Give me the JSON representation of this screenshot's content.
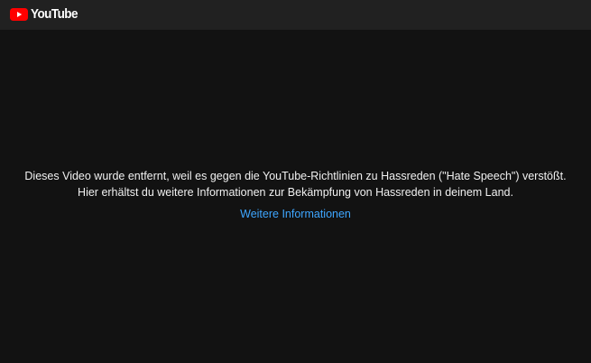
{
  "header": {
    "logo_text": "YouTube"
  },
  "error": {
    "message": "Dieses Video wurde entfernt, weil es gegen die YouTube-Richtlinien zu Hassreden (\"Hate Speech\") verstößt. Hier erhältst du weitere Informationen zur Bekämpfung von Hassreden in deinem Land.",
    "link_label": "Weitere Informationen"
  },
  "colors": {
    "background": "#121212",
    "header_background": "#212121",
    "brand_red": "#ff0000",
    "link": "#3ea6ff"
  },
  "icons": {
    "logo": "youtube-play-icon"
  }
}
